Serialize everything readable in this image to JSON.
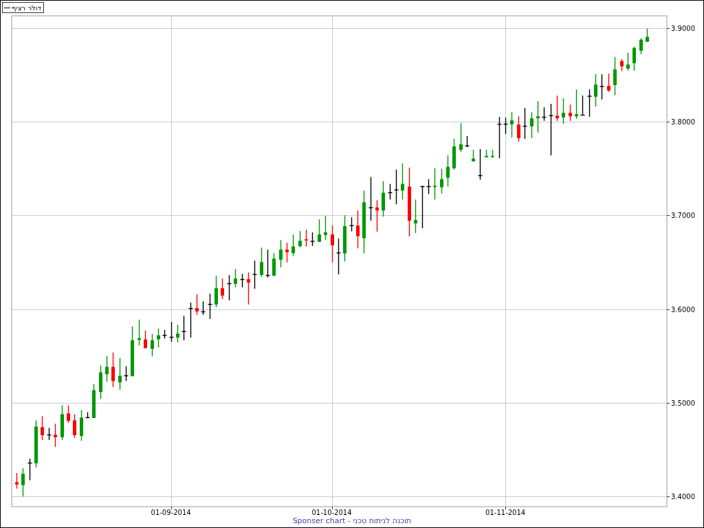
{
  "legend": {
    "label": "דולר רציף"
  },
  "chart_data": {
    "type": "candlestick",
    "grid": true,
    "ylim": [
      3.389,
      3.9132
    ],
    "yticks": [
      {
        "value": 3.4,
        "label": "3.4000"
      },
      {
        "value": 3.5,
        "label": "3.5000"
      },
      {
        "value": 3.6,
        "label": "3.6000"
      },
      {
        "value": 3.7,
        "label": "3.7000"
      },
      {
        "value": 3.8,
        "label": "3.8000"
      },
      {
        "value": 3.9,
        "label": "3.9000"
      }
    ],
    "categories": [
      null,
      null,
      null,
      null,
      null,
      null,
      null,
      null,
      null,
      null,
      null,
      null,
      null,
      null,
      null,
      null,
      null,
      null,
      null,
      null,
      null,
      null,
      null,
      null,
      "01-09-2014",
      null,
      null,
      null,
      null,
      null,
      null,
      null,
      null,
      null,
      null,
      null,
      null,
      null,
      null,
      null,
      null,
      null,
      null,
      null,
      null,
      null,
      null,
      null,
      null,
      "01-10-2014",
      null,
      null,
      null,
      null,
      null,
      null,
      null,
      null,
      null,
      null,
      null,
      null,
      null,
      null,
      null,
      null,
      null,
      null,
      null,
      null,
      null,
      null,
      null,
      null,
      null,
      null,
      "01-11-2014",
      null,
      null,
      null,
      null,
      null,
      null,
      null,
      null,
      null,
      null,
      null,
      null,
      null,
      null,
      null,
      null,
      null,
      null,
      null,
      null,
      null,
      null
    ],
    "ohlc": [
      [
        3.4151,
        3.4249,
        3.4083,
        3.4127
      ],
      [
        3.412,
        3.43,
        3.4,
        3.4241
      ],
      [
        3.4356,
        3.4402,
        3.4171,
        3.4356
      ],
      [
        3.4354,
        3.4812,
        3.431,
        3.4746
      ],
      [
        3.4739,
        3.4856,
        3.4602,
        3.4654
      ],
      [
        3.4656,
        3.4732,
        3.4602,
        3.4656
      ],
      [
        3.4659,
        3.4776,
        3.4529,
        3.4632
      ],
      [
        3.4632,
        3.4973,
        3.4602,
        3.4878
      ],
      [
        3.4885,
        3.4973,
        3.4785,
        3.4807
      ],
      [
        3.4812,
        3.4878,
        3.4624,
        3.4654
      ],
      [
        3.4646,
        3.4922,
        3.4595,
        3.4841
      ],
      [
        3.4841,
        3.49,
        3.4837,
        3.4841
      ],
      [
        3.4837,
        3.52,
        3.4837,
        3.5134
      ],
      [
        3.5115,
        3.5398,
        3.5041,
        3.5324
      ],
      [
        3.5305,
        3.55,
        3.5224,
        3.5383
      ],
      [
        3.5383,
        3.5537,
        3.5166,
        3.5232
      ],
      [
        3.5217,
        3.5478,
        3.5137,
        3.5288
      ],
      [
        3.5288,
        3.539,
        3.5232,
        3.5288
      ],
      [
        3.5283,
        3.5815,
        3.5283,
        3.5668
      ],
      [
        3.5671,
        3.5888,
        3.5612,
        3.569
      ],
      [
        3.5676,
        3.5771,
        3.5583,
        3.5583
      ],
      [
        3.5576,
        3.5734,
        3.5495,
        3.5668
      ],
      [
        3.5678,
        3.5793,
        3.559,
        3.572
      ],
      [
        3.572,
        3.5778,
        3.5685,
        3.572
      ],
      [
        3.5699,
        3.5863,
        3.5652,
        3.5699
      ],
      [
        3.5696,
        3.5833,
        3.5645,
        3.5738
      ],
      [
        3.576,
        3.5929,
        3.5667,
        3.576
      ],
      [
        3.6007,
        3.6069,
        3.5696,
        3.6007
      ],
      [
        3.601,
        3.6157,
        3.5939,
        3.5975
      ],
      [
        3.5971,
        3.6083,
        3.5939,
        3.5971
      ],
      [
        3.6051,
        3.6164,
        3.5895,
        3.6051
      ],
      [
        3.6049,
        3.6355,
        3.602,
        3.6223
      ],
      [
        3.6223,
        3.6326,
        3.6108,
        3.6145
      ],
      [
        3.6272,
        3.6363,
        3.6093,
        3.6272
      ],
      [
        3.627,
        3.6429,
        3.6233,
        3.6326
      ],
      [
        3.6316,
        3.6377,
        3.6233,
        3.6316
      ],
      [
        3.6319,
        3.6392,
        3.6049,
        3.6284
      ],
      [
        3.637,
        3.6517,
        3.6218,
        3.637
      ],
      [
        3.6365,
        3.6657,
        3.6343,
        3.6502
      ],
      [
        3.636,
        3.6635,
        3.6336,
        3.636
      ],
      [
        3.6358,
        3.6598,
        3.635,
        3.6539
      ],
      [
        3.6527,
        3.6738,
        3.6446,
        3.6635
      ],
      [
        3.6635,
        3.6708,
        3.6498,
        3.6608
      ],
      [
        3.6598,
        3.6797,
        3.6564,
        3.6669
      ],
      [
        3.6672,
        3.6833,
        3.6659,
        3.673
      ],
      [
        3.6745,
        3.6848,
        3.6667,
        3.6733
      ],
      [
        3.6723,
        3.6819,
        3.6674,
        3.6723
      ],
      [
        3.6718,
        3.6958,
        3.6718,
        3.6797
      ],
      [
        3.6792,
        3.6995,
        3.674,
        3.6819
      ],
      [
        3.6797,
        3.6892,
        3.6498,
        3.6681
      ],
      [
        3.66,
        3.6755,
        3.6371,
        3.66
      ],
      [
        3.6595,
        3.7002,
        3.651,
        3.6886
      ],
      [
        3.6891,
        3.6981,
        3.683,
        3.6891
      ],
      [
        3.6893,
        3.7053,
        3.6648,
        3.6779
      ],
      [
        3.6757,
        3.7265,
        3.6595,
        3.7141
      ],
      [
        3.7083,
        3.741,
        3.6944,
        3.7083
      ],
      [
        3.7085,
        3.7163,
        3.6828,
        3.7053
      ],
      [
        3.7053,
        3.7367,
        3.6988,
        3.7243
      ],
      [
        3.7243,
        3.7337,
        3.717,
        3.7243
      ],
      [
        3.7272,
        3.749,
        3.7119,
        3.7272
      ],
      [
        3.7265,
        3.7556,
        3.717,
        3.7337
      ],
      [
        3.7308,
        3.7512,
        3.6777,
        3.6944
      ],
      [
        3.6915,
        3.717,
        3.6813,
        3.6951
      ],
      [
        3.7308,
        3.7316,
        3.6864,
        3.7308
      ],
      [
        3.7308,
        3.7388,
        3.7228,
        3.7308
      ],
      [
        3.7303,
        3.7505,
        3.717,
        3.7316
      ],
      [
        3.7301,
        3.7498,
        3.7235,
        3.7388
      ],
      [
        3.7403,
        3.7643,
        3.7308,
        3.7519
      ],
      [
        3.7505,
        3.7818,
        3.749,
        3.7738
      ],
      [
        3.7701,
        3.7985,
        3.768,
        3.776
      ],
      [
        3.7743,
        3.7847,
        3.7731,
        3.7743
      ],
      [
        3.7578,
        3.7701,
        3.7578,
        3.7607
      ],
      [
        3.7425,
        3.7709,
        3.7381,
        3.7425
      ],
      [
        3.7621,
        3.7701,
        3.7621,
        3.7636
      ],
      [
        3.7631,
        3.7701,
        3.7614,
        3.7636
      ],
      [
        3.7975,
        3.8052,
        3.7612,
        3.7975
      ],
      [
        3.7975,
        3.8044,
        3.787,
        3.7975
      ],
      [
        3.7973,
        3.8103,
        3.7833,
        3.8015
      ],
      [
        3.7971,
        3.8059,
        3.7789,
        3.7826
      ],
      [
        3.7953,
        3.8147,
        3.7818,
        3.7953
      ],
      [
        3.7951,
        3.8103,
        3.7826,
        3.8037
      ],
      [
        3.8037,
        3.8221,
        3.7885,
        3.8059
      ],
      [
        3.8049,
        3.8155,
        3.801,
        3.8049
      ],
      [
        3.8066,
        3.8192,
        3.7641,
        3.8066
      ],
      [
        3.8066,
        3.828,
        3.801,
        3.8039
      ],
      [
        3.8047,
        3.8251,
        3.798,
        3.8096
      ],
      [
        3.8096,
        3.8184,
        3.801,
        3.8059
      ],
      [
        3.8059,
        3.8346,
        3.8032,
        3.8081
      ],
      [
        3.8071,
        3.828,
        3.8071,
        3.8071
      ],
      [
        3.8273,
        3.8346,
        3.8054,
        3.8273
      ],
      [
        3.8268,
        3.8509,
        3.8162,
        3.8398
      ],
      [
        3.8378,
        3.8509,
        3.8238,
        3.8378
      ],
      [
        3.8383,
        3.8516,
        3.8319,
        3.8334
      ],
      [
        3.8393,
        3.8693,
        3.8283,
        3.856
      ],
      [
        3.8649,
        3.8671,
        3.8541,
        3.8592
      ],
      [
        3.8568,
        3.8737,
        3.8548,
        3.8612
      ],
      [
        3.8627,
        3.8803,
        3.8545,
        3.8789
      ],
      [
        3.8759,
        3.8892,
        3.8722,
        3.8877
      ],
      [
        3.8855,
        3.8995,
        3.8855,
        3.8907
      ]
    ]
  },
  "footer": "Sponser chart - תוכנה לניתוח טכני"
}
